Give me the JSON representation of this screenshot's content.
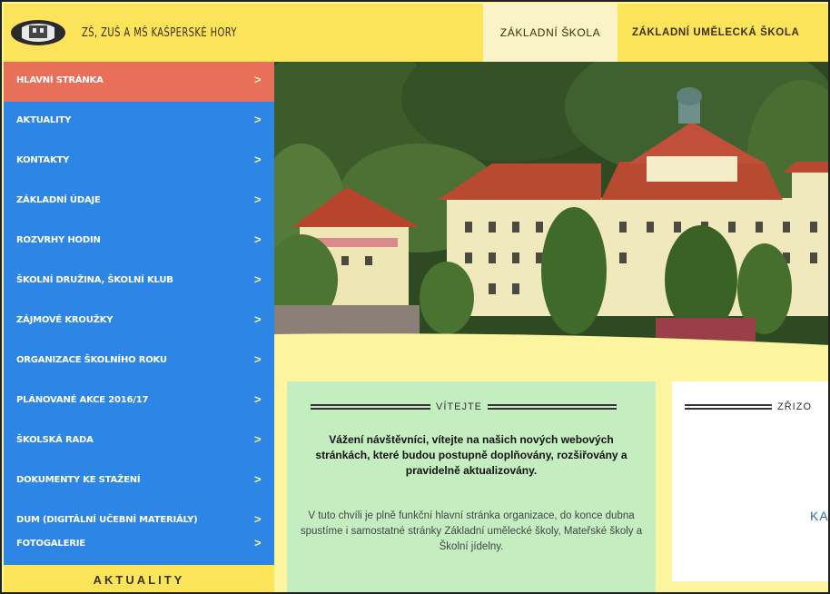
{
  "header": {
    "site_title": "ZŠ, ZUŠ A MŠ KAŠPERSKÉ HORY",
    "tabs": [
      {
        "label": "ZÁKLADNÍ ŠKOLA"
      },
      {
        "label": "ZÁKLADNÍ UMĚLECKÁ ŠKOLA"
      }
    ]
  },
  "sidebar": {
    "items": [
      {
        "label": "HLAVNÍ STRÁNKA",
        "active": true
      },
      {
        "label": "AKTUALITY"
      },
      {
        "label": "KONTAKTY"
      },
      {
        "label": "ZÁKLADNÍ ÚDAJE"
      },
      {
        "label": "ROZVRHY HODIN"
      },
      {
        "label": "ŠKOLNÍ DRUŽINA, ŠKOLNÍ KLUB"
      },
      {
        "label": "ZÁJMOVÉ KROUŽKY"
      },
      {
        "label": "ORGANIZACE ŠKOLNÍHO ROKU"
      },
      {
        "label": "PLÁNOVANÉ AKCE 2016/17"
      },
      {
        "label": "ŠKOLSKÁ RADA"
      },
      {
        "label": "DOKUMENTY KE STAŽENÍ"
      },
      {
        "label": "DUM (DIGITÁLNÍ UČEBNÍ MATERIÁLY)"
      },
      {
        "label": "FOTOGALERIE"
      }
    ],
    "chevron": ">",
    "heading": "AKTUALITY"
  },
  "welcome": {
    "title": "VÍTEJTE",
    "bold_text": "Vážení návštěvníci, vítejte na našich nových webových stránkách, které budou postupně doplňovány, rozšiřovány a pravidelně aktualizovány.",
    "text": "V tuto chvíli je plně funkční hlavní stránka organizace, do konce dubna spustíme i samostatné stránky Základní umělecké školy, Mateřské školy a Školní jídelny."
  },
  "right_box": {
    "title": "ZŘIZO",
    "fragment": "KA"
  },
  "colors": {
    "header_bg": "#fce45a",
    "nav_blue": "#2d86e6",
    "nav_active": "#e8705a",
    "welcome_bg": "#c4eec0",
    "page_bg": "#fdf4a0"
  }
}
